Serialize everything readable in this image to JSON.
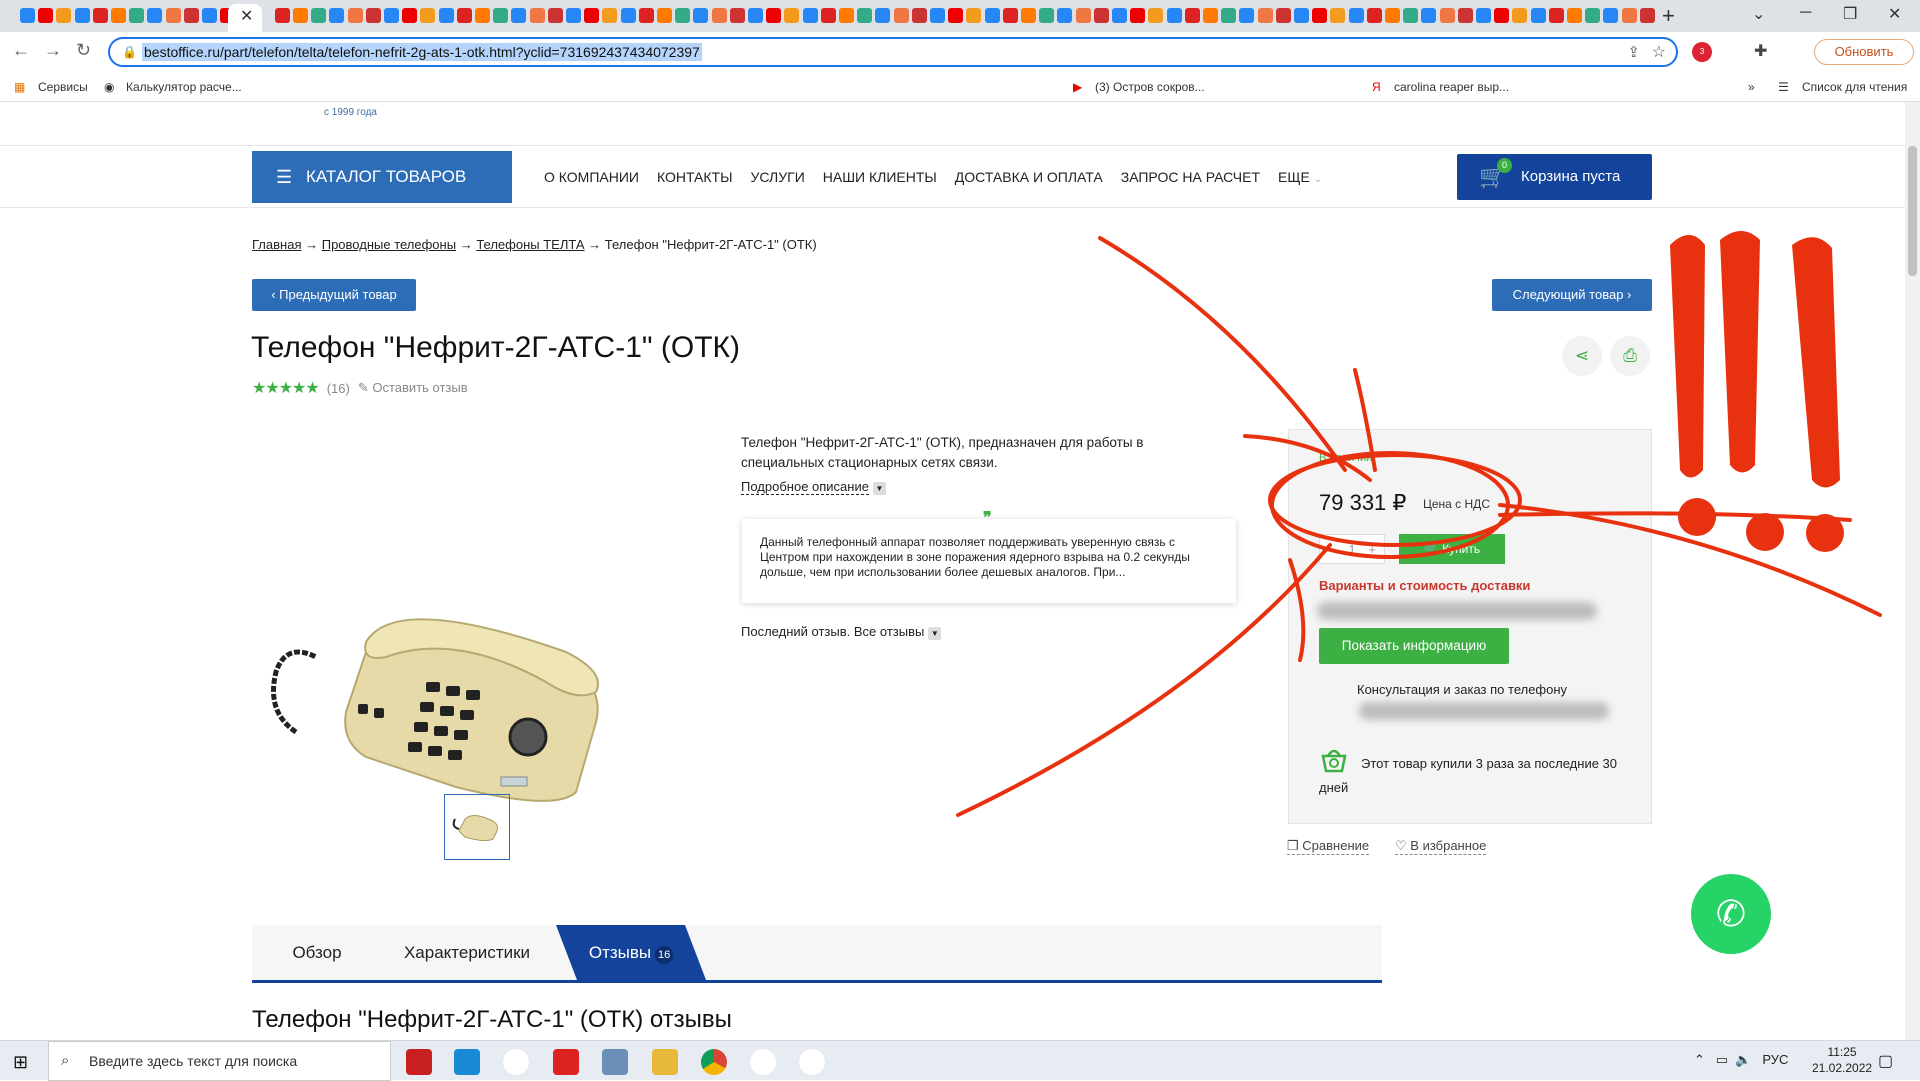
{
  "browser": {
    "url": "bestoffice.ru/part/telefon/telta/telefon-nefrit-2g-ats-1-otk.html?yclid=731692437434072397",
    "update_label": "Обновить",
    "adblock_count": "3",
    "tab_close": "✕",
    "new_tab": "+",
    "bookmarks": [
      "Сервисы",
      "Калькулятор расче...",
      "(3) Остров сокров...",
      "carolina reaper выр..."
    ],
    "bookmarks_more": "»",
    "reading_list": "Список для чтения"
  },
  "site": {
    "since": "с 1999 года",
    "catalog_label": "КАТАЛОГ ТОВАРОВ",
    "nav": [
      "О КОМПАНИИ",
      "КОНТАКТЫ",
      "УСЛУГИ",
      "НАШИ КЛИЕНТЫ",
      "ДОСТАВКА И ОПЛАТА",
      "ЗАПРОС НА РАСЧЕТ",
      "ЕЩЕ"
    ],
    "cart_label": "Корзина пуста",
    "cart_count": "0"
  },
  "breadcrumb": [
    "Главная",
    "Проводные телефоны",
    "Телефоны ТЕЛТА",
    "Телефон \"Нефрит-2Г-АТС-1\" (ОТК)"
  ],
  "breadcrumb_sep": "→",
  "product": {
    "prev_label": "‹ Предыдущий товар",
    "next_label": "Следующий товар ›",
    "title": "Телефон \"Нефрит-2Г-АТС-1\" (ОТК)",
    "rating_stars": 5,
    "rating_count": "(16)",
    "leave_review": "Оставить отзыв",
    "short_desc": "Телефон \"Нефрит-2Г-АТС-1\" (ОТК), предназначен для работы в специальных стационарных сетях связи.",
    "more_desc": "Подробное описание",
    "review_excerpt": "Данный телефонный аппарат позволяет поддерживать уверенную связь с Центром при нахождении в зоне поражения ядерного взрыва на 0.2 секунды дольше, чем при использовании более дешевых аналогов. При...",
    "last_review_label": "Последний отзыв.",
    "all_reviews": "Все отзывы"
  },
  "buy": {
    "in_stock": "В наличии",
    "price": "79 331 ₽",
    "vat": "Цена с НДС",
    "qty": "1",
    "qty_minus": "−",
    "qty_plus": "+",
    "buy_label": "Купить",
    "delivery": "Варианты и стоимость доставки",
    "info_btn": "Показать информацию",
    "consult": "Консультация и заказ по телефону",
    "bought": "Этот товар купили 3 раза за последние 30 дней"
  },
  "actions": {
    "compare": "Сравнение",
    "favorite": "В избранное"
  },
  "tabs": [
    {
      "label": "Обзор"
    },
    {
      "label": "Характеристики"
    },
    {
      "label": "Отзывы",
      "count": "16"
    }
  ],
  "reviews_heading": "Телефон \"Нефрит-2Г-АТС-1\" (ОТК) отзывы",
  "taskbar": {
    "search_placeholder": "Введите здесь текст для поиска",
    "lang": "РУС",
    "time": "11:25",
    "date": "21.02.2022"
  },
  "colors": {
    "brand_blue": "#2d6db7",
    "dark_blue": "#13439b",
    "green": "#3cb043",
    "annotation_red": "#e8320f"
  }
}
